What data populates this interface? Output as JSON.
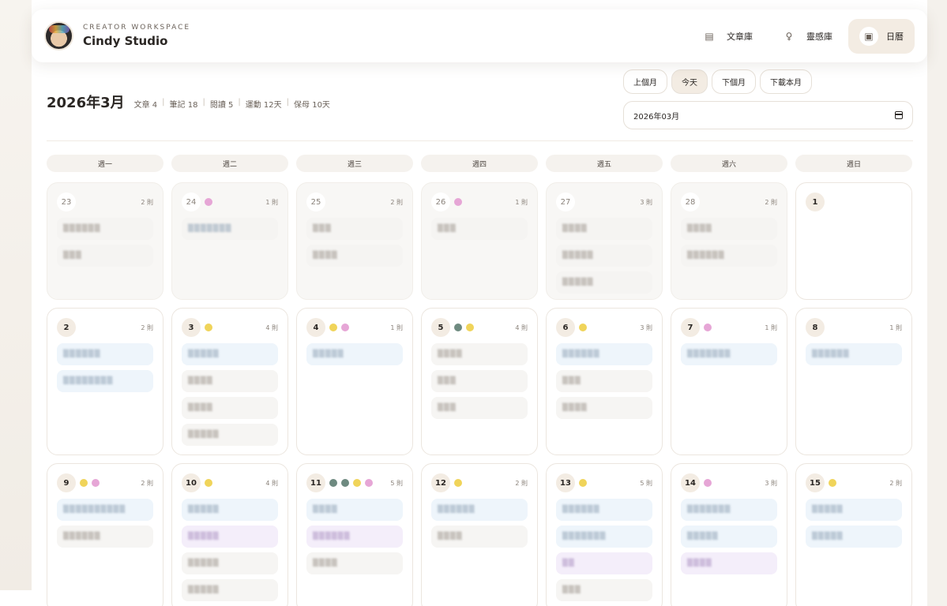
{
  "header": {
    "kicker": "CREATOR WORKSPACE",
    "title": "Cindy Studio",
    "nav": [
      {
        "label": "文章庫",
        "icon": "document-icon",
        "glyph": "▤",
        "active": false
      },
      {
        "label": "靈感庫",
        "icon": "lightbulb-icon",
        "glyph": "♀",
        "active": false
      },
      {
        "label": "日曆",
        "icon": "calendar-icon",
        "glyph": "▣",
        "active": true
      }
    ]
  },
  "toolbar": {
    "month_title": "2026年3月",
    "stats": [
      "文章 4",
      "筆記 18",
      "閱讀 5",
      "運動 12天",
      "保母 10天"
    ],
    "prev": "上個月",
    "today": "今天",
    "next": "下個月",
    "download": "下載本月",
    "month_value": "2026年03月"
  },
  "weekdays": [
    "週一",
    "週二",
    "週三",
    "週四",
    "週五",
    "週六",
    "週日"
  ],
  "weeks": [
    {
      "row": "r0",
      "days": [
        {
          "num": "23",
          "out": true,
          "dots": [],
          "count": "2 則",
          "entries": [
            {
              "t": "▒▒▒▒▒▒",
              "c": "gray"
            },
            {
              "t": "▒▒▒",
              "c": "gray"
            }
          ]
        },
        {
          "num": "24",
          "out": true,
          "dots": [
            "pink"
          ],
          "count": "1 則",
          "entries": [
            {
              "t": "▒▒▒▒▒▒▒",
              "c": "blue"
            }
          ]
        },
        {
          "num": "25",
          "out": true,
          "dots": [],
          "count": "2 則",
          "entries": [
            {
              "t": "▒▒▒",
              "c": "gray"
            },
            {
              "t": "▒▒▒▒",
              "c": "gray"
            }
          ]
        },
        {
          "num": "26",
          "out": true,
          "dots": [
            "pink"
          ],
          "count": "1 則",
          "entries": [
            {
              "t": "▒▒▒",
              "c": "gray"
            }
          ]
        },
        {
          "num": "27",
          "out": true,
          "dots": [],
          "count": "3 則",
          "entries": [
            {
              "t": "▒▒▒▒",
              "c": "gray"
            },
            {
              "t": "▒▒▒▒▒",
              "c": "gray"
            },
            {
              "t": "▒▒▒▒▒",
              "c": "gray"
            }
          ]
        },
        {
          "num": "28",
          "out": true,
          "dots": [],
          "count": "2 則",
          "entries": [
            {
              "t": "▒▒▒▒",
              "c": "gray"
            },
            {
              "t": "▒▒▒▒▒▒",
              "c": "gray"
            }
          ]
        },
        {
          "num": "1",
          "out": false,
          "dots": [],
          "count": "",
          "entries": []
        }
      ]
    },
    {
      "row": "r1",
      "days": [
        {
          "num": "2",
          "out": false,
          "dots": [],
          "count": "2 則",
          "entries": [
            {
              "t": "▒▒▒▒▒▒",
              "c": "blue"
            },
            {
              "t": "▒▒▒▒▒▒▒▒",
              "c": "blue"
            }
          ]
        },
        {
          "num": "3",
          "out": false,
          "dots": [
            "yellow"
          ],
          "count": "4 則",
          "entries": [
            {
              "t": "▒▒▒▒▒",
              "c": "blue"
            },
            {
              "t": "▒▒▒▒",
              "c": "gray"
            },
            {
              "t": "▒▒▒▒",
              "c": "gray"
            },
            {
              "t": "▒▒▒▒▒",
              "c": "gray"
            }
          ]
        },
        {
          "num": "4",
          "out": false,
          "dots": [
            "yellow",
            "pink"
          ],
          "count": "1 則",
          "entries": [
            {
              "t": "▒▒▒▒▒",
              "c": "blue"
            }
          ]
        },
        {
          "num": "5",
          "out": false,
          "dots": [
            "green",
            "yellow"
          ],
          "count": "4 則",
          "entries": [
            {
              "t": "▒▒▒▒",
              "c": "gray"
            },
            {
              "t": "▒▒▒",
              "c": "gray"
            },
            {
              "t": "▒▒▒",
              "c": "gray"
            }
          ]
        },
        {
          "num": "6",
          "out": false,
          "dots": [
            "yellow"
          ],
          "count": "3 則",
          "entries": [
            {
              "t": "▒▒▒▒▒▒",
              "c": "blue"
            },
            {
              "t": "▒▒▒",
              "c": "gray"
            },
            {
              "t": "▒▒▒▒",
              "c": "gray"
            }
          ]
        },
        {
          "num": "7",
          "out": false,
          "dots": [
            "pink"
          ],
          "count": "1 則",
          "entries": [
            {
              "t": "▒▒▒▒▒▒▒",
              "c": "blue"
            }
          ]
        },
        {
          "num": "8",
          "out": false,
          "dots": [],
          "count": "1 則",
          "entries": [
            {
              "t": "▒▒▒▒▒▒",
              "c": "blue"
            }
          ]
        }
      ]
    },
    {
      "row": "r2",
      "days": [
        {
          "num": "9",
          "out": false,
          "dots": [
            "yellow",
            "pink"
          ],
          "count": "2 則",
          "entries": [
            {
              "t": "▒▒▒▒▒▒▒▒▒▒",
              "c": "blue"
            },
            {
              "t": "▒▒▒▒▒▒",
              "c": "gray"
            }
          ]
        },
        {
          "num": "10",
          "out": false,
          "dots": [
            "yellow"
          ],
          "count": "4 則",
          "entries": [
            {
              "t": "▒▒▒▒▒",
              "c": "blue"
            },
            {
              "t": "▒▒▒▒▒",
              "c": "purple"
            },
            {
              "t": "▒▒▒▒▒",
              "c": "gray"
            },
            {
              "t": "▒▒▒▒▒",
              "c": "gray"
            }
          ]
        },
        {
          "num": "11",
          "out": false,
          "dots": [
            "green",
            "green",
            "yellow",
            "pink"
          ],
          "count": "5 則",
          "entries": [
            {
              "t": "▒▒▒▒",
              "c": "blue"
            },
            {
              "t": "▒▒▒▒▒▒",
              "c": "purple"
            },
            {
              "t": "▒▒▒▒",
              "c": "gray"
            }
          ]
        },
        {
          "num": "12",
          "out": false,
          "dots": [
            "yellow"
          ],
          "count": "2 則",
          "entries": [
            {
              "t": "▒▒▒▒▒▒",
              "c": "blue"
            },
            {
              "t": "▒▒▒▒",
              "c": "gray"
            }
          ]
        },
        {
          "num": "13",
          "out": false,
          "dots": [
            "yellow"
          ],
          "count": "5 則",
          "entries": [
            {
              "t": "▒▒▒▒▒▒",
              "c": "blue"
            },
            {
              "t": "▒▒▒▒▒▒▒",
              "c": "blue"
            },
            {
              "t": "▒▒",
              "c": "purple"
            },
            {
              "t": "▒▒▒",
              "c": "gray"
            }
          ]
        },
        {
          "num": "14",
          "out": false,
          "dots": [
            "pink"
          ],
          "count": "3 則",
          "entries": [
            {
              "t": "▒▒▒▒▒▒▒",
              "c": "blue"
            },
            {
              "t": "▒▒▒▒▒",
              "c": "blue"
            },
            {
              "t": "▒▒▒▒",
              "c": "purple"
            }
          ]
        },
        {
          "num": "15",
          "out": false,
          "dots": [
            "yellow"
          ],
          "count": "2 則",
          "entries": [
            {
              "t": "▒▒▒▒▒",
              "c": "blue"
            },
            {
              "t": "▒▒▒▒▒",
              "c": "blue"
            }
          ]
        }
      ]
    }
  ]
}
